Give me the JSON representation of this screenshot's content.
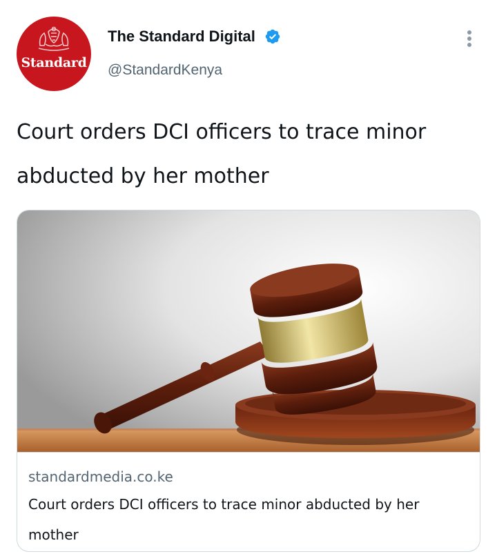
{
  "author": {
    "avatar_text": "Standard",
    "avatar_color": "#c8161e",
    "name": "The Standard Digital",
    "handle": "@StandardKenya",
    "verified_icon": "verified-badge-icon",
    "verified_color": "#1d9bf0"
  },
  "more_icon": "more-options-icon",
  "tweet": {
    "text": "Court orders DCI officers to trace minor abducted by her mother"
  },
  "card": {
    "image_icon": "gavel-image",
    "domain": "standardmedia.co.ke",
    "title": "Court orders DCI officers to trace minor abducted by her mother"
  }
}
